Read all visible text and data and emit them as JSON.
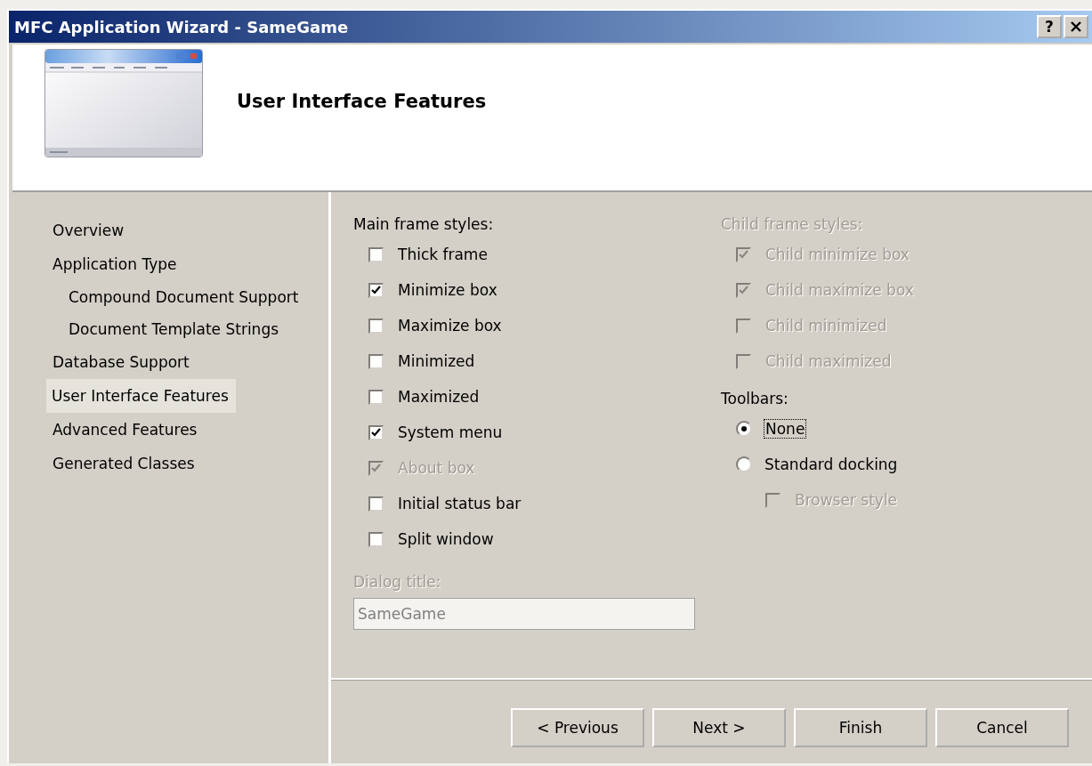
{
  "window": {
    "title": "MFC Application Wizard - SameGame",
    "help_button": "?"
  },
  "header": {
    "title": "User Interface Features"
  },
  "sidebar": {
    "items": [
      {
        "label": "Overview",
        "selected": false
      },
      {
        "label": "Application Type",
        "selected": false,
        "children": [
          {
            "label": "Compound Document Support",
            "selected": false
          },
          {
            "label": "Document Template Strings",
            "selected": false
          }
        ]
      },
      {
        "label": "Database Support",
        "selected": false
      },
      {
        "label": "User Interface Features",
        "selected": true
      },
      {
        "label": "Advanced Features",
        "selected": false
      },
      {
        "label": "Generated Classes",
        "selected": false
      }
    ]
  },
  "main_frame_styles": {
    "label": "Main frame styles:",
    "options": [
      {
        "label": "Thick frame",
        "checked": false,
        "disabled": false
      },
      {
        "label": "Minimize box",
        "checked": true,
        "disabled": false
      },
      {
        "label": "Maximize box",
        "checked": false,
        "disabled": false
      },
      {
        "label": "Minimized",
        "checked": false,
        "disabled": false
      },
      {
        "label": "Maximized",
        "checked": false,
        "disabled": false
      },
      {
        "label": "System menu",
        "checked": true,
        "disabled": false
      },
      {
        "label": "About box",
        "checked": true,
        "disabled": true
      },
      {
        "label": "Initial status bar",
        "checked": false,
        "disabled": false
      },
      {
        "label": "Split window",
        "checked": false,
        "disabled": false
      }
    ]
  },
  "dialog_title": {
    "label": "Dialog title:",
    "value": "SameGame",
    "disabled": true
  },
  "child_frame_styles": {
    "label": "Child frame styles:",
    "disabled": true,
    "options": [
      {
        "label": "Child minimize box",
        "checked": true,
        "disabled": true
      },
      {
        "label": "Child maximize box",
        "checked": true,
        "disabled": true
      },
      {
        "label": "Child minimized",
        "checked": false,
        "disabled": true
      },
      {
        "label": "Child maximized",
        "checked": false,
        "disabled": true
      }
    ]
  },
  "toolbars": {
    "label": "Toolbars:",
    "options": [
      {
        "label": "None",
        "selected": true,
        "focused": true
      },
      {
        "label": "Standard docking",
        "selected": false,
        "focused": false
      }
    ],
    "browser_style": {
      "label": "Browser style",
      "checked": false,
      "disabled": true
    }
  },
  "buttons": [
    "< Previous",
    "Next >",
    "Finish",
    "Cancel"
  ]
}
